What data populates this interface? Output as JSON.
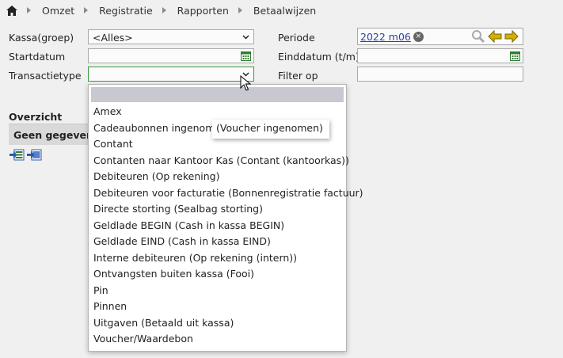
{
  "breadcrumb": {
    "items": [
      "Omzet",
      "Registratie",
      "Rapporten",
      "Betaalwijzen"
    ]
  },
  "form": {
    "kassa_label": "Kassa(groep)",
    "kassa_value": "<Alles>",
    "startdatum_label": "Startdatum",
    "startdatum_value": "",
    "transactietype_label": "Transactietype",
    "transactietype_value": "",
    "periode_label": "Periode",
    "periode_tag": "2022 m06",
    "einddatum_label": "Einddatum (t/m)",
    "einddatum_value": "",
    "filter_label": "Filter op",
    "filter_value": ""
  },
  "overview": {
    "title": "Overzicht",
    "empty_text": "Geen gegeven"
  },
  "dropdown": {
    "options": [
      "Amex",
      "Cadeaubonnen ingenomen",
      "Contant",
      "Contanten naar Kantoor Kas (Contant (kantoorkas))",
      "Debiteuren (Op rekening)",
      "Debiteuren voor facturatie (Bonnenregistratie factuur)",
      "Directe storting (Sealbag storting)",
      "Geldlade BEGIN (Cash in kassa BEGIN)",
      "Geldlade EIND (Cash in kassa EIND)",
      "Interne debiteuren (Op rekening (intern))",
      "Ontvangsten buiten kassa (Fooi)",
      "Pin",
      "Pinnen",
      "Uitgaven (Betaald uit kassa)",
      "Voucher/Waardebon"
    ]
  },
  "tooltip": {
    "text": "(Voucher ingenomen)"
  },
  "colors": {
    "calendar": "#2e7d32",
    "arrows": "#d4b000",
    "tag_link": "#2a3fa6"
  },
  "icons": [
    "home-icon",
    "calendar-icon",
    "search-icon",
    "arrow-left-icon",
    "arrow-right-icon",
    "export-excel-icon",
    "export-pdf-icon"
  ]
}
